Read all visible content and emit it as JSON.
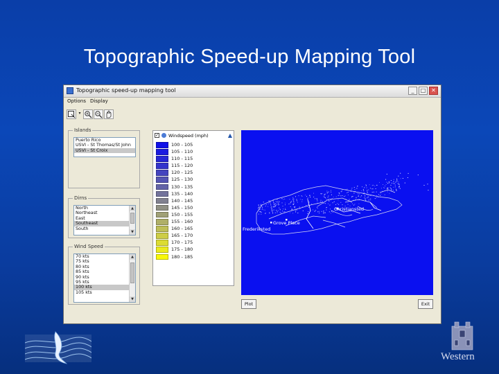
{
  "slide": {
    "title": "Topographic Speed-up Mapping Tool",
    "background_top": "#0a3ea8",
    "background_bottom": "#062f7e",
    "footer_logo_text": "Western"
  },
  "window": {
    "title": "Topographic speed-up mapping tool",
    "controls": [
      "_",
      "□",
      "✕"
    ],
    "menu": [
      "Options",
      "Display"
    ],
    "toolbar_icons": [
      "zoom-box-icon",
      "zoom-in-icon",
      "zoom-out-icon",
      "pan-hand-icon"
    ]
  },
  "islands": {
    "label": "Islands",
    "items": [
      "Puerto Rico",
      "USVI - St Thomas/St John",
      "USVI - St Croix"
    ],
    "selected_index": 2
  },
  "directions": {
    "label": "Dirns",
    "items": [
      "North",
      "Northeast",
      "East",
      "Southeast",
      "South"
    ],
    "selected_index": 3
  },
  "wind_speed": {
    "label": "Wind Speed",
    "items": [
      "70 kts",
      "75 kts",
      "80 kts",
      "85 kts",
      "90 kts",
      "95 kts",
      "100 kts",
      "105 kts"
    ],
    "selected_index": 6
  },
  "legend": {
    "layer_name": "Windspeed (mph)",
    "rows": [
      {
        "range": "100 - 105",
        "color": "#1010e8"
      },
      {
        "range": "105 - 110",
        "color": "#1a1ae0"
      },
      {
        "range": "110 - 115",
        "color": "#2626d6"
      },
      {
        "range": "115 - 120",
        "color": "#3434cc"
      },
      {
        "range": "120 - 125",
        "color": "#4444bf"
      },
      {
        "range": "125 - 130",
        "color": "#5555b3"
      },
      {
        "range": "130 - 135",
        "color": "#6464a8"
      },
      {
        "range": "135 - 140",
        "color": "#73739c"
      },
      {
        "range": "140 - 145",
        "color": "#828290"
      },
      {
        "range": "145 - 150",
        "color": "#919184"
      },
      {
        "range": "150 - 155",
        "color": "#a0a076"
      },
      {
        "range": "155 - 160",
        "color": "#afaf68"
      },
      {
        "range": "160 - 165",
        "color": "#bebe58"
      },
      {
        "range": "165 - 170",
        "color": "#cdcd46"
      },
      {
        "range": "170 - 175",
        "color": "#dcdc33"
      },
      {
        "range": "175 - 180",
        "color": "#ebeb1e"
      },
      {
        "range": "180 - 185",
        "color": "#f8f80a"
      }
    ]
  },
  "map": {
    "background": "#0a10f0",
    "labels": {
      "christiansted": "Christiansted",
      "grove_place": "Grove Place",
      "frederiksted": "Frederiksted"
    }
  },
  "buttons": {
    "plot": "Plot",
    "exit": "Exit"
  }
}
